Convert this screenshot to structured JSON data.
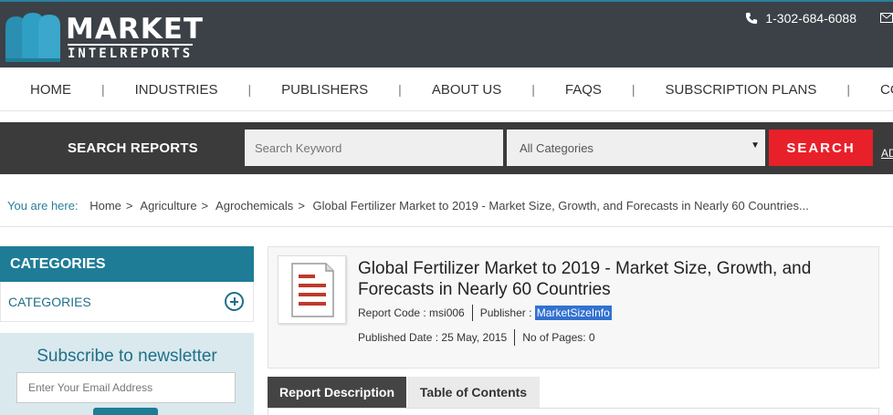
{
  "header": {
    "logo_word1": "MARKET",
    "logo_word2": "INTELREPORTS",
    "phone": "1-302-684-6088"
  },
  "nav": {
    "items": [
      "HOME",
      "INDUSTRIES",
      "PUBLISHERS",
      "ABOUT US",
      "FAQS",
      "SUBSCRIPTION PLANS",
      "CONTACT"
    ]
  },
  "search": {
    "label": "SEARCH REPORTS",
    "keyword_placeholder": "Search Keyword",
    "category_value": "All Categories",
    "button": "SEARCH",
    "advanced_link": "AD"
  },
  "breadcrumb": {
    "lead": "You are here:",
    "items": [
      "Home",
      "Agriculture",
      "Agrochemicals",
      "Global Fertilizer Market to 2019 - Market Size, Growth, and Forecasts in Nearly 60 Countries..."
    ]
  },
  "sidebar": {
    "header": "CATEGORIES",
    "row_label": "CATEGORIES",
    "newsletter_title": "Subscribe to newsletter",
    "email_placeholder": "Enter Your Email Address"
  },
  "report": {
    "title": "Global Fertilizer Market to 2019 - Market Size, Growth, and Forecasts in Nearly 60 Countries",
    "code_label": "Report Code : msi006",
    "publisher_label": "Publisher : ",
    "publisher_name": "MarketSizeInfo",
    "published_date": "Published Date : 25 May, 2015",
    "pages": "No of Pages: 0"
  },
  "tabs": [
    "Report Description",
    "Table of Contents"
  ],
  "colors": {
    "accent": "#1f7c97",
    "search_button": "#e8202a",
    "header_bg": "#3b4147"
  }
}
